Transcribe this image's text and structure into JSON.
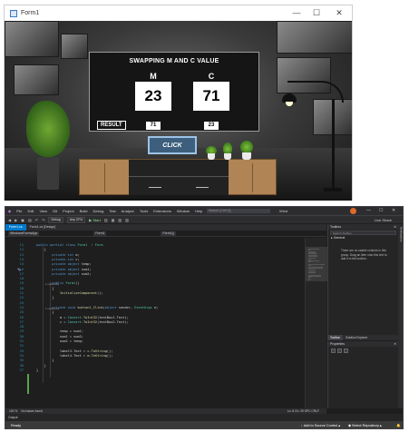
{
  "form": {
    "title": "Form1",
    "minimize": "—",
    "maximize": "☐",
    "close": "✕",
    "panel_title": "SWAPPING M AND C VALUE",
    "m_label": "M",
    "c_label": "C",
    "m_value": "23",
    "c_value": "71",
    "result_label": "RESULT",
    "result_m": "71",
    "result_c": "23",
    "click_label": "CLICK"
  },
  "vs": {
    "menu": [
      "File",
      "Edit",
      "View",
      "Git",
      "Project",
      "Build",
      "Debug",
      "Test",
      "Analyze",
      "Tools",
      "Extensions",
      "Window",
      "Help"
    ],
    "search_placeholder": "Search (Ctrl+Q)",
    "solution_name": "Wind",
    "live_share": "Live Share",
    "toolbar_config": "Debug",
    "toolbar_platform": "Any CPU",
    "toolbar_start": "▶ Start",
    "tabs": [
      "Form1.cs",
      "Form1.cs [Design]"
    ],
    "nav_project": "WindowsFormsApp",
    "nav_class": "Form1",
    "nav_member": "Form1()",
    "code_lines": [
      {
        "n": "11",
        "ref": "",
        "html_parts": [
          [
            "kw",
            "public partial class "
          ],
          [
            "ty",
            "Form1"
          ],
          [
            "",
            "  : "
          ],
          [
            "ty",
            "Form"
          ]
        ]
      },
      {
        "n": "12",
        "html_parts": [
          [
            "",
            "    {"
          ]
        ]
      },
      {
        "n": "13",
        "html_parts": [
          [
            "kw",
            "        private int "
          ],
          [
            "",
            "m;"
          ]
        ]
      },
      {
        "n": "14",
        "html_parts": [
          [
            "kw",
            "        private int "
          ],
          [
            "",
            "c;"
          ]
        ]
      },
      {
        "n": "15",
        "html_parts": [
          [
            "kw",
            "        private object "
          ],
          [
            "",
            "temp;"
          ]
        ]
      },
      {
        "n": "16",
        "html_parts": [
          [
            "kw",
            "        private object "
          ],
          [
            "",
            "num1;"
          ]
        ]
      },
      {
        "n": "17",
        "html_parts": [
          [
            "kw",
            "        private object "
          ],
          [
            "",
            "num2;"
          ]
        ]
      },
      {
        "n": "18",
        "html_parts": [
          [
            "",
            ""
          ]
        ]
      },
      {
        "n": "19",
        "html_parts": [
          [
            "kw",
            "        public "
          ],
          [
            "ty",
            "Form1"
          ],
          [
            "",
            "()"
          ]
        ]
      },
      {
        "n": "20",
        "html_parts": [
          [
            "",
            "        {"
          ]
        ]
      },
      {
        "n": "21",
        "html_parts": [
          [
            "mt",
            "            InitializeComponent"
          ],
          [
            "",
            "();"
          ]
        ]
      },
      {
        "n": "22",
        "html_parts": [
          [
            "",
            "        }"
          ]
        ]
      },
      {
        "n": "23",
        "html_parts": [
          [
            "",
            ""
          ]
        ]
      },
      {
        "n": "24",
        "html_parts": [
          [
            "kw",
            "        private void "
          ],
          [
            "mt",
            "button1_Click"
          ],
          [
            "",
            "("
          ],
          [
            "kw",
            "object "
          ],
          [
            "",
            "sender, "
          ],
          [
            "ty",
            "EventArgs "
          ],
          [
            "",
            "e)"
          ]
        ]
      },
      {
        "n": "25",
        "html_parts": [
          [
            "",
            "        {"
          ]
        ]
      },
      {
        "n": "26",
        "html_parts": [
          [
            "",
            "            m = "
          ],
          [
            "ty",
            "Convert"
          ],
          [
            "",
            "."
          ],
          [
            "mt",
            "ToInt32"
          ],
          [
            "",
            "(textBox1.Text);"
          ]
        ]
      },
      {
        "n": "27",
        "html_parts": [
          [
            "",
            "            c = "
          ],
          [
            "ty",
            "Convert"
          ],
          [
            "",
            "."
          ],
          [
            "mt",
            "ToInt32"
          ],
          [
            "",
            "(textBox2.Text);"
          ]
        ]
      },
      {
        "n": "28",
        "html_parts": [
          [
            "",
            ""
          ]
        ]
      },
      {
        "n": "29",
        "html_parts": [
          [
            "",
            "            temp = num1;"
          ]
        ]
      },
      {
        "n": "30",
        "html_parts": [
          [
            "",
            "            num1 = num2;"
          ]
        ]
      },
      {
        "n": "31",
        "html_parts": [
          [
            "",
            "            num2 = temp;"
          ]
        ]
      },
      {
        "n": "32",
        "html_parts": [
          [
            "",
            ""
          ]
        ]
      },
      {
        "n": "33",
        "html_parts": [
          [
            "",
            "            label3.Text = c."
          ],
          [
            "mt",
            "ToString"
          ],
          [
            "",
            "();"
          ]
        ]
      },
      {
        "n": "34",
        "html_parts": [
          [
            "",
            "            label4.Text = m."
          ],
          [
            "mt",
            "ToString"
          ],
          [
            "",
            "();"
          ]
        ]
      },
      {
        "n": "35",
        "html_parts": [
          [
            "",
            "        }"
          ]
        ]
      },
      {
        "n": "36",
        "html_parts": [
          [
            "",
            "    }"
          ]
        ]
      },
      {
        "n": "37",
        "html_parts": [
          [
            "",
            "}"
          ]
        ]
      }
    ],
    "ref_label": "1 reference",
    "toolbox_title": "Toolbox",
    "toolbox_search": "Search Toolbox",
    "toolbox_group": "▸ General",
    "toolbox_message": "There are no usable controls in this group. Drag an item onto this text to add it to the toolbox.",
    "toolbox_tab": "Toolbox",
    "solution_tab": "Solution Explorer",
    "properties_title": "Properties",
    "side_strip": "Notifications",
    "zoom": "100 %",
    "issues": "No issues found",
    "cursor_pos": "Ln: 8   Ch: 29   SPC   CRLF",
    "output_label": "Output",
    "status_ready": "Ready",
    "status_source": "↑ Add to Source Control ▴",
    "status_repo": "◆ Select Repository ▴",
    "status_bell": "🔔"
  }
}
